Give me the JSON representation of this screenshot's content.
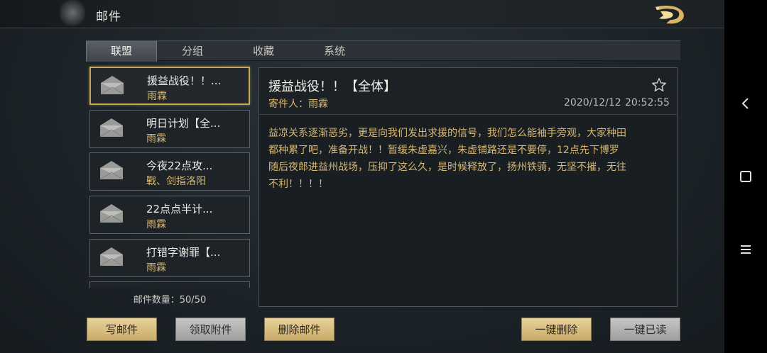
{
  "header": {
    "title": "邮件"
  },
  "tabs": [
    {
      "label": "联盟",
      "active": true
    },
    {
      "label": "分组",
      "active": false
    },
    {
      "label": "收藏",
      "active": false
    },
    {
      "label": "系统",
      "active": false
    }
  ],
  "mails": [
    {
      "subject": "援益战役！！...",
      "sender": "雨霖",
      "selected": true
    },
    {
      "subject": "明日计划【全...",
      "sender": "雨霖",
      "selected": false
    },
    {
      "subject": "今夜22点攻...",
      "sender": "戰、剑指洛阳",
      "selected": false
    },
    {
      "subject": "22点点半计...",
      "sender": "雨霖",
      "selected": false
    },
    {
      "subject": "打错字谢罪【...",
      "sender": "雨霖",
      "selected": false
    }
  ],
  "mail_count": "邮件数量：50/50",
  "detail": {
    "title": "援益战役！！【全体】",
    "from": "寄件人：雨霖",
    "date": "2020/12/12",
    "time": "20:52:55",
    "body_lines": [
      "益凉关系逐渐恶劣，更是向我们发出求援的信号，我们怎么能袖手旁观，大家种田",
      "都种累了吧，准备开战！！暂缓朱虚嘉兴，朱虚铺路还是不要停，12点先下博罗",
      "随后夜郎进益州战场，压抑了这么久，是时候释放了，扬州铁骑，无坚不摧，无往",
      "不利！！！！"
    ]
  },
  "buttons": {
    "write": "写邮件",
    "collect": "领取附件",
    "delete": "删除邮件",
    "delete_all": "一键删除",
    "read_all": "一键已读"
  },
  "colors": {
    "accent_gold": "#d8b875",
    "button_gold": "#e8d29a",
    "button_gray": "#c6c6c4",
    "selected_border": "#c9a85a"
  },
  "icons": {
    "mail_item": "envelope-icon",
    "favorite": "star-outline-icon",
    "logo": "dragon-logo-icon",
    "nav_back": "chevron-left-icon",
    "nav_home": "square-icon",
    "nav_menu": "menu-icon"
  }
}
